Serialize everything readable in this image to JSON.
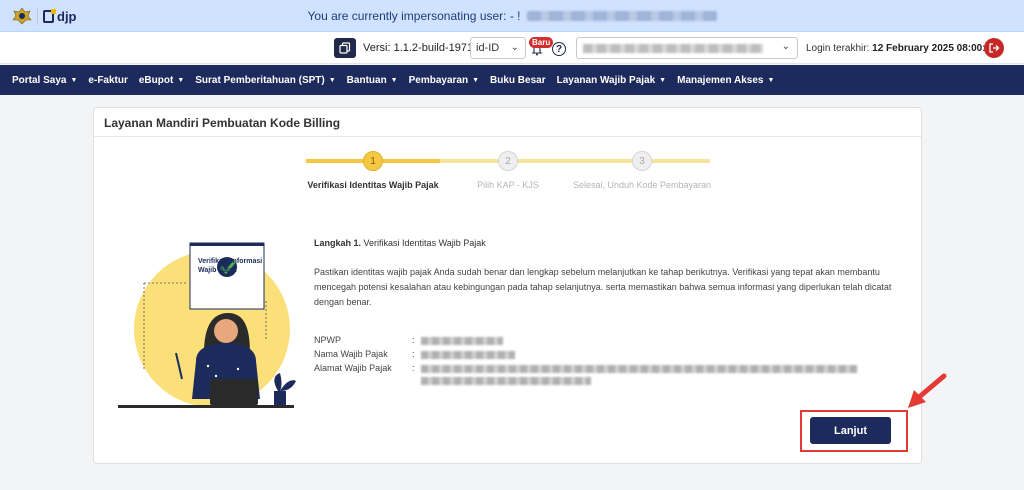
{
  "banner": {
    "text": "You are currently impersonating user: - !"
  },
  "header": {
    "logo_text": "djp",
    "version_label": "Versi:",
    "version_value": "1.1.2-build-1971",
    "language": "id-ID",
    "badge": "Baru",
    "help": "?",
    "last_login_label": "Login terakhir:",
    "last_login_value": "12 February 2025 08:00:05"
  },
  "nav": {
    "items": [
      "Portal Saya",
      "e-Faktur",
      "eBupot",
      "Surat Pemberitahuan (SPT)",
      "Bantuan",
      "Pembayaran",
      "Buku Besar",
      "Layanan Wajib Pajak",
      "Manajemen Akses"
    ]
  },
  "card": {
    "title": "Layanan Mandiri Pembuatan Kode Billing",
    "steps": [
      {
        "number": "1",
        "label": "Verifikasi Identitas Wajib Pajak"
      },
      {
        "number": "2",
        "label": "Pilih KAP - KJS"
      },
      {
        "number": "3",
        "label": "Selesai, Unduh Kode Pembayaran"
      }
    ],
    "illustration_title": "Verifikasi Informasi Wajib Pajak",
    "step_heading_label": "Langkah 1.",
    "step_heading_text": "Verifikasi Identitas Wajib Pajak",
    "description": "Pastikan identitas wajib pajak Anda sudah benar dan lengkap sebelum melanjutkan ke tahap berikutnya. Verifikasi yang tepat akan membantu mencegah potensi kesalahan atau kebingungan pada tahap selanjutnya. serta memastikan bahwa semua informasi yang diperlukan telah dicatat dengan benar.",
    "fields": [
      {
        "label": "NPWP",
        "colon": ":"
      },
      {
        "label": "Nama Wajib Pajak",
        "colon": ":"
      },
      {
        "label": "Alamat Wajib Pajak",
        "colon": ":"
      }
    ],
    "next_button": "Lanjut"
  },
  "colors": {
    "navy": "#1c2a5c",
    "step_active": "#f5c842",
    "step_track": "#f7e3a0",
    "highlight": "#e53935"
  },
  "icons": [
    "kemenkeu-emblem-icon",
    "djp-logo-icon",
    "copy-icon",
    "chevron-down-icon",
    "bell-icon",
    "help-icon",
    "logout-icon",
    "check-shield-icon",
    "arrow-icon"
  ]
}
